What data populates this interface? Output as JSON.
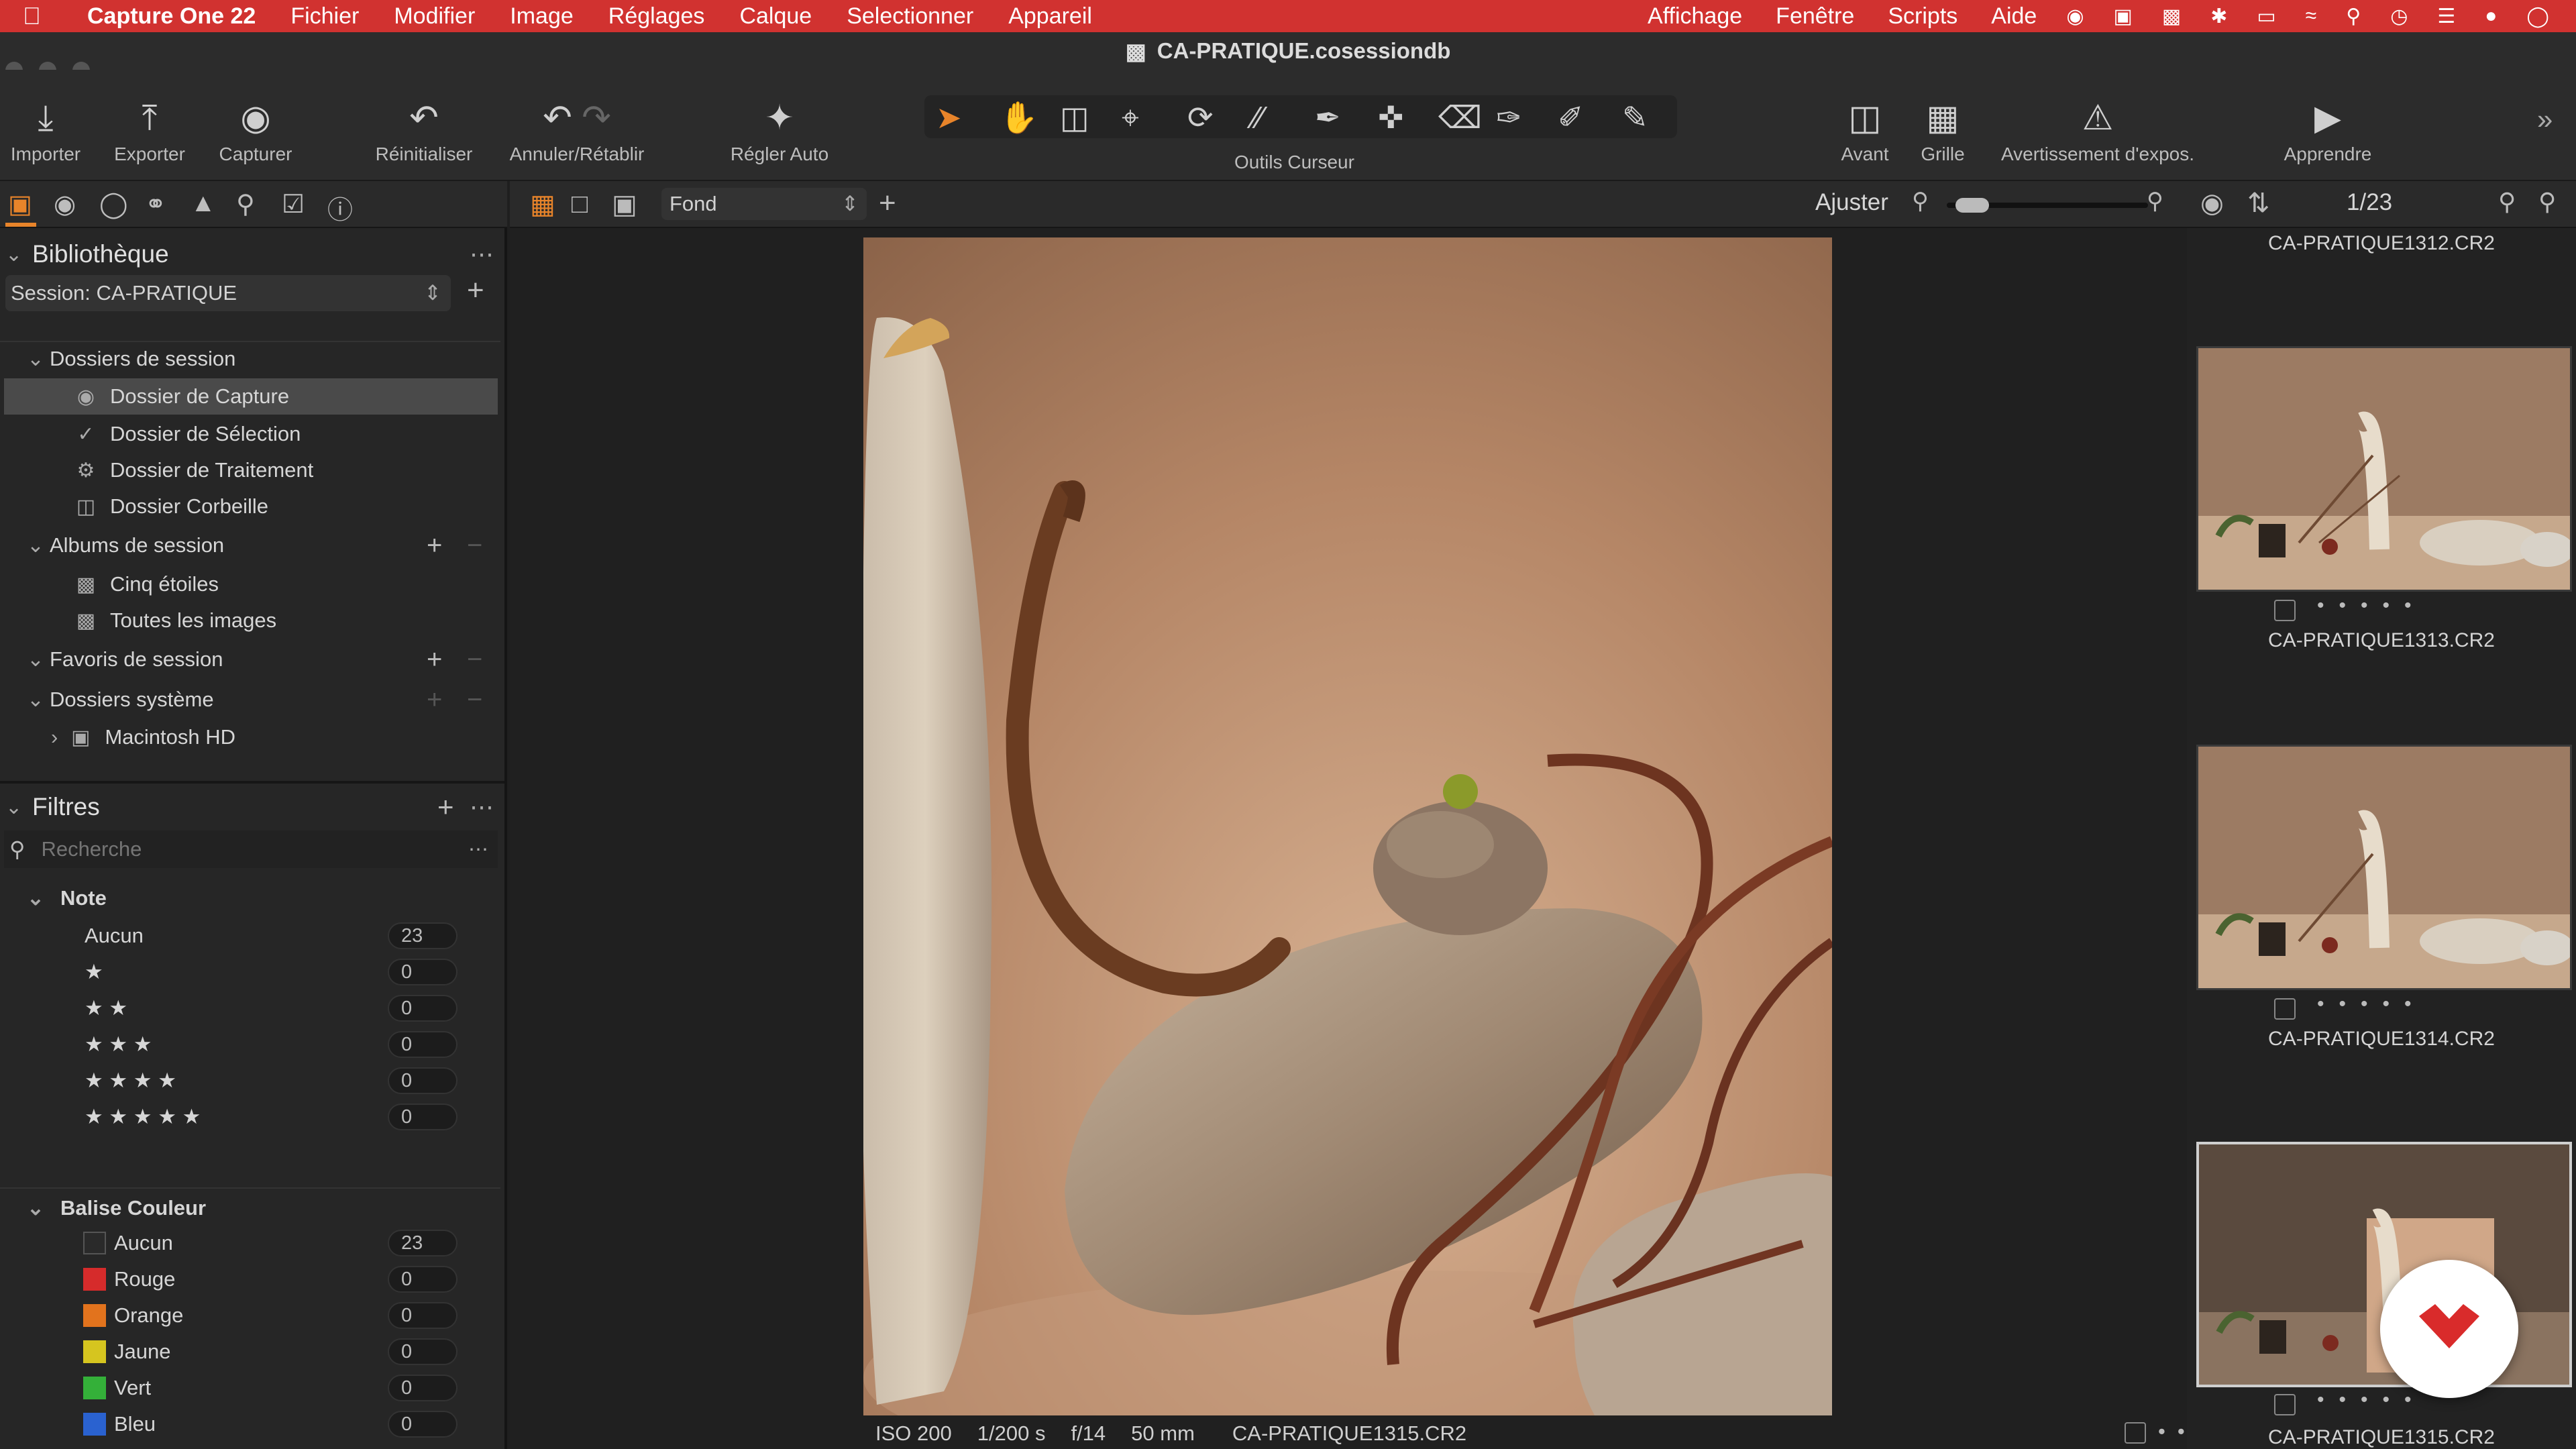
{
  "menubar": {
    "app": "Capture One 22",
    "items": [
      "Fichier",
      "Modifier",
      "Image",
      "Réglages",
      "Calque",
      "Selectionner",
      "Appareil"
    ],
    "right_items": [
      "Affichage",
      "Fenêtre",
      "Scripts",
      "Aide"
    ]
  },
  "window": {
    "title": "CA-PRATIQUE.cosessiondb"
  },
  "toolbar": {
    "import": "Importer",
    "export": "Exporter",
    "capture": "Capturer",
    "reset": "Réinitialiser",
    "undo_redo": "Annuler/Rétablir",
    "auto_adjust": "Régler Auto",
    "cursor_tools": "Outils Curseur",
    "before": "Avant",
    "grid": "Grille",
    "exposure_warning": "Avertissement d'expos.",
    "learn": "Apprendre"
  },
  "library": {
    "title": "Bibliothèque",
    "session": "Session: CA-PRATIQUE",
    "session_folders": "Dossiers de session",
    "capture_folder": "Dossier de Capture",
    "selection_folder": "Dossier de Sélection",
    "output_folder": "Dossier de Traitement",
    "trash_folder": "Dossier Corbeille",
    "session_albums": "Albums de session",
    "five_stars": "Cinq étoiles",
    "all_images": "Toutes les images",
    "session_favorites": "Favoris de session",
    "system_folders": "Dossiers système",
    "macintosh_hd": "Macintosh HD"
  },
  "filters": {
    "title": "Filtres",
    "search_placeholder": "Recherche",
    "rating_title": "Note",
    "ratings": [
      {
        "label": "Aucun",
        "count": "23"
      },
      {
        "label": "★",
        "count": "0"
      },
      {
        "label": "★ ★",
        "count": "0"
      },
      {
        "label": "★ ★ ★",
        "count": "0"
      },
      {
        "label": "★ ★ ★ ★",
        "count": "0"
      },
      {
        "label": "★ ★ ★ ★ ★",
        "count": "0"
      }
    ],
    "color_title": "Balise Couleur",
    "colors": [
      {
        "label": "Aucun",
        "count": "23",
        "color": "#2a2a2a"
      },
      {
        "label": "Rouge",
        "count": "0",
        "color": "#d62b2b"
      },
      {
        "label": "Orange",
        "count": "0",
        "color": "#e2731d"
      },
      {
        "label": "Jaune",
        "count": "0",
        "color": "#d6c51f"
      },
      {
        "label": "Vert",
        "count": "0",
        "color": "#34b039"
      },
      {
        "label": "Bleu",
        "count": "0",
        "color": "#2a62d0"
      }
    ]
  },
  "viewer": {
    "layer": "Fond",
    "fit": "Ajuster",
    "zoom_fraction": 0.05,
    "info": {
      "iso": "ISO 200",
      "shutter": "1/200 s",
      "aperture": "f/14",
      "focal": "50 mm",
      "file": "CA-PRATIQUE1315.CR2"
    }
  },
  "browser": {
    "counter": "1/23",
    "thumbs": [
      {
        "name": "CA-PRATIQUE1312.CR2"
      },
      {
        "name": "CA-PRATIQUE1313.CR2"
      },
      {
        "name": "CA-PRATIQUE1314.CR2"
      },
      {
        "name": "CA-PRATIQUE1315.CR2"
      }
    ]
  },
  "colors": {
    "menubar": "#d13230",
    "accent": "#e8842a",
    "selection": "#4a4a4a"
  }
}
